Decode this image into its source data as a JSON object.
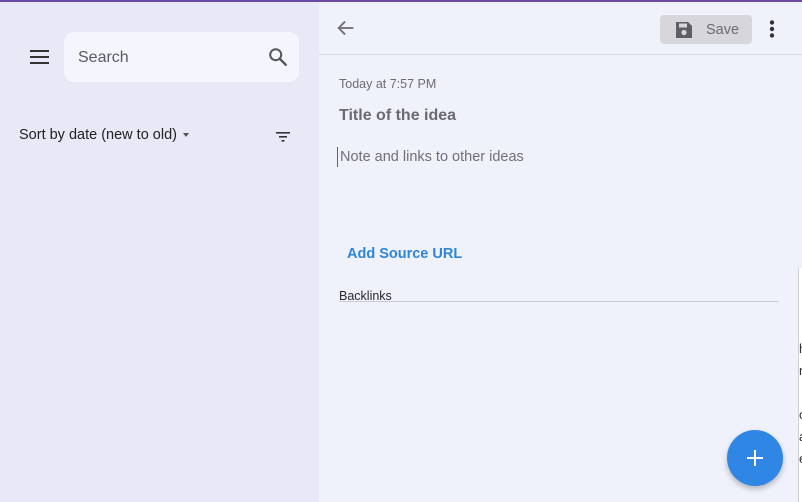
{
  "sidebar": {
    "search": {
      "placeholder": "Search",
      "value": ""
    },
    "sort": {
      "label": "Sort by date (new to old)"
    },
    "icons": {
      "menu": "menu-icon",
      "search": "search-icon",
      "filter": "filter-icon"
    }
  },
  "editor": {
    "header": {
      "save_label": "Save",
      "icons": {
        "back": "arrow-back-icon",
        "save": "floppy-disk-icon",
        "more": "more-vert-icon"
      }
    },
    "timestamp": "Today at 7:57 PM",
    "title_placeholder": "Title of the idea",
    "note_placeholder": "Note and links to other ideas",
    "add_source_label": "Add Source URL",
    "backlinks_heading": "Backlinks"
  },
  "fab": {
    "label": "+",
    "icon": "add-icon"
  },
  "colors": {
    "accent": "#2f86e4",
    "link": "#2f86d6",
    "sidebar_bg": "#e8e8f7",
    "editor_bg": "#eff1fb",
    "top_bar": "#6b4aa0"
  }
}
